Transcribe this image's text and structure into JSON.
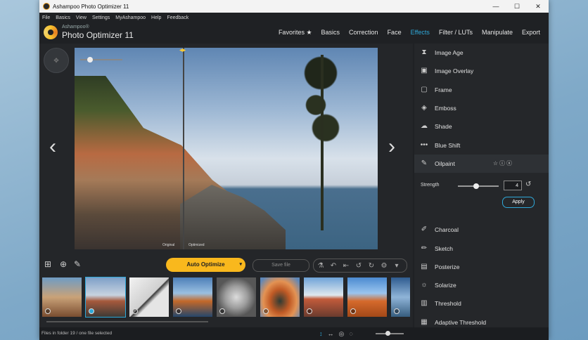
{
  "window": {
    "title": "Ashampoo Photo Optimizer 11",
    "controls": [
      "—",
      "☐",
      "✕"
    ]
  },
  "menu": [
    "File",
    "Basics",
    "View",
    "Settings",
    "MyAshampoo",
    "Help",
    "Feedback"
  ],
  "brand": {
    "small": "Ashampoo®",
    "name": "Photo Optimizer 11"
  },
  "nav": {
    "tabs": [
      "Favorites ★",
      "Basics",
      "Correction",
      "Face",
      "Effects",
      "Filter / LUTs",
      "Manipulate",
      "Export"
    ],
    "active": "Effects",
    "accent": "#2fa8d8"
  },
  "preview": {
    "label_original": "Original",
    "label_optimized": "Optimized"
  },
  "toolbar": {
    "auto_optimize": "Auto Optimize",
    "save_file": "Save file",
    "auto_color": "#f9b81d"
  },
  "effects": {
    "items": [
      "Image Age",
      "Image Overlay",
      "Frame",
      "Emboss",
      "Shade",
      "Blue Shift",
      "Oilpaint",
      "Charcoal",
      "Sketch",
      "Posterize",
      "Solarize",
      "Threshold",
      "Adaptive Threshold"
    ],
    "selected": "Oilpaint",
    "strength_label": "Strength",
    "strength_value": "4",
    "apply_label": "Apply"
  },
  "status": {
    "text": "Files in folder 19 / one file selected"
  }
}
